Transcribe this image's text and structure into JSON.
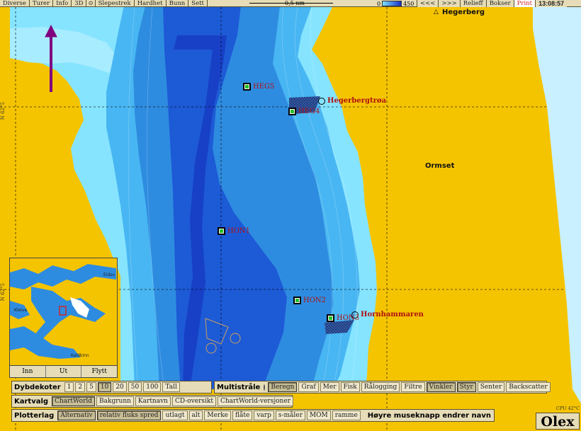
{
  "toolbar": {
    "items": [
      "Diverse",
      "Turer",
      "Info",
      "3D",
      "Slepestrek",
      "Hardhet",
      "Bunn",
      "Sett"
    ],
    "scale_label": "0,5 nm",
    "depth_min": "0",
    "depth_max": "450",
    "nav_back": "<<<",
    "nav_fwd": ">>>",
    "relieff": "Relieff",
    "bokser": "Bokser",
    "print": "Print",
    "clock": "13:08:57"
  },
  "places": {
    "hegerberg": "Hegerberg",
    "ormset": "Ormset",
    "hegerbergtroa": "Hegerbergtrøa",
    "hornhammaren": "Hornhammaren"
  },
  "stations": {
    "heg5": "HEG5",
    "heg4": "HEG4",
    "hon1": "HON1",
    "hon2": "HON2",
    "hon3": "HON3"
  },
  "lat_labels": {
    "upper": "N 62°5",
    "lower": "N 62°5"
  },
  "inset": {
    "label_east": "Eidsv.",
    "label_west": "Kleive",
    "label_south": "Kaldkinn",
    "btn_in": "Inn",
    "btn_out": "Ut",
    "btn_move": "Flytt"
  },
  "dybdekoter": {
    "title": "Dybdekoter",
    "options": [
      "1",
      "2",
      "5",
      "10",
      "20",
      "50",
      "100",
      "Tall"
    ],
    "selected": "10"
  },
  "multistraale": {
    "title": "Multistråle",
    "options": [
      "Beregn",
      "Graf",
      "Mer",
      "Fisk",
      "Rålogging",
      "Filtre",
      "Vinkler",
      "Styr",
      "Senter",
      "Backscatter"
    ]
  },
  "kartvalg": {
    "title": "Kartvalg",
    "options": [
      "ChartWorld",
      "Bakgrunn",
      "Kartnavn",
      "CD-oversikt",
      "ChartWorld-versjoner"
    ]
  },
  "plotterlag": {
    "title": "Plotterlag",
    "options": [
      "Alternativ",
      "relativ fluks spred",
      "utlagt",
      "alt",
      "Merke",
      "flåte",
      "varp",
      "s-måler",
      "MOM",
      "ramme"
    ],
    "hint": "Høyre museknapp endrer navn"
  },
  "status": {
    "cpu": "CPU 42°C"
  },
  "logo": "Olex",
  "colors": {
    "land": "#F5C400",
    "shallow": "#7FE0FF",
    "deep": "#1530C8",
    "station": "#27C027",
    "label_red": "#B01010"
  }
}
